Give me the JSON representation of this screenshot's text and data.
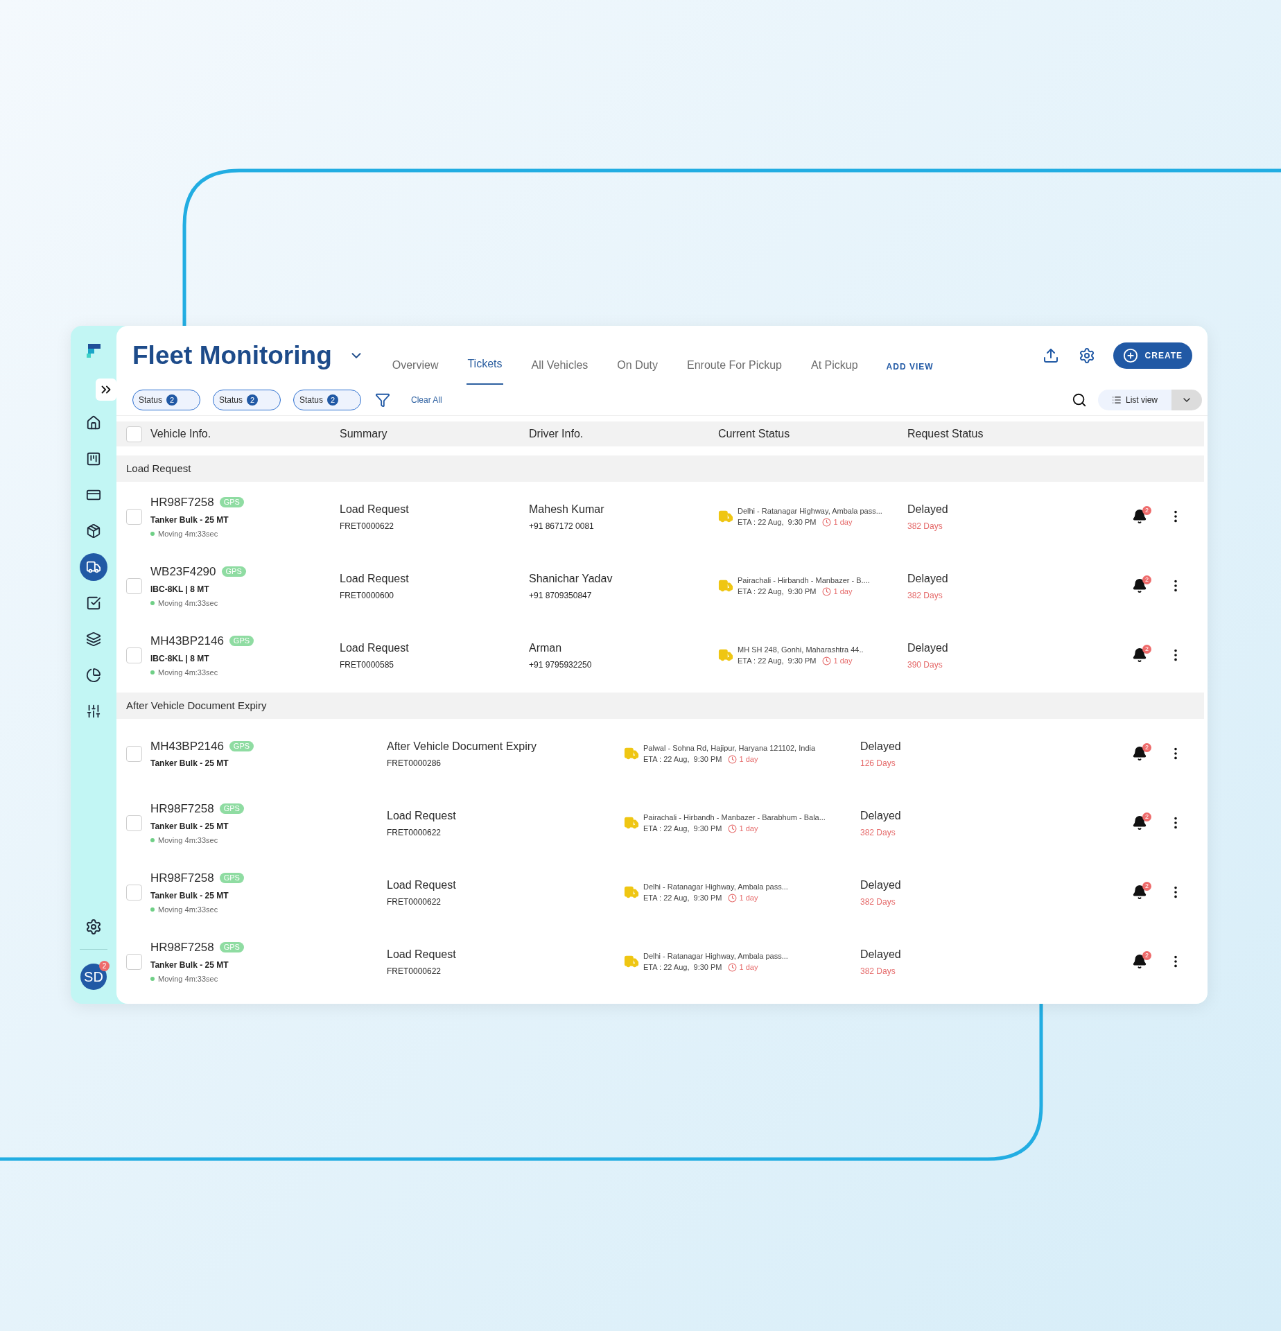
{
  "app": {
    "title": "Fleet Monitoring"
  },
  "sidebar": {
    "items": [
      {
        "selected": false
      },
      {
        "selected": false
      },
      {
        "selected": false
      },
      {
        "selected": false
      },
      {
        "selected": true
      },
      {
        "selected": false
      },
      {
        "selected": false
      },
      {
        "selected": false
      },
      {
        "selected": false
      }
    ],
    "avatar": {
      "initials": "SD",
      "badge": "2"
    }
  },
  "tabs": [
    {
      "label": "Overview",
      "selected": false
    },
    {
      "label": "Tickets",
      "selected": true
    },
    {
      "label": "All Vehicles",
      "selected": false
    },
    {
      "label": "On Duty",
      "selected": false
    },
    {
      "label": "Enroute For Pickup",
      "selected": false
    },
    {
      "label": "At Pickup",
      "selected": false
    }
  ],
  "add_view": "ADD VIEW",
  "create_button": "CREATE",
  "filters": [
    {
      "label": "Status",
      "count": "2"
    },
    {
      "label": "Status",
      "count": "2"
    },
    {
      "label": "Status",
      "count": "2"
    }
  ],
  "clear_all": "Clear All",
  "view_select": "List view",
  "table": {
    "select_all_checked": false,
    "columns": [
      "Vehicle Info.",
      "Summary",
      "Driver Info.",
      "Current Status",
      "Request Status"
    ],
    "groups": [
      {
        "title": "Load Request",
        "rows": [
          {
            "checked": false,
            "plate": "HR98F7258",
            "gps": "GPS",
            "type": "Tanker Bulk - 25 MT",
            "moving": "Moving 4m:33sec",
            "summary": "Load Request",
            "ticket": "FRET0000622",
            "driver": "Mahesh Kumar",
            "phone": "+91 867172 0081",
            "location": "Delhi - Ratanagar Highway, Ambala pass...",
            "eta": "ETA : 22 Aug,  9:30 PM",
            "duration": "1 day",
            "status": "Delayed",
            "days": "382 Days",
            "alerts": "2"
          },
          {
            "checked": false,
            "plate": "WB23F4290",
            "gps": "GPS",
            "type": "IBC-8KL  | 8 MT",
            "moving": "Moving 4m:33sec",
            "summary": "Load Request",
            "ticket": "FRET0000600",
            "driver": "Shanichar Yadav",
            "phone": "+91 8709350847",
            "location": "Pairachali - Hirbandh - Manbazer - B....",
            "eta": "ETA : 22 Aug,  9:30 PM",
            "duration": "1 day",
            "status": "Delayed",
            "days": "382 Days",
            "alerts": "2"
          },
          {
            "checked": false,
            "plate": "MH43BP2146",
            "gps": "GPS",
            "type": "IBC-8KL  | 8 MT",
            "moving": "Moving 4m:33sec",
            "summary": "Load Request",
            "ticket": "FRET0000585",
            "driver": "Arman",
            "phone": "+91 9795932250",
            "location": "MH SH 248, Gonhi, Maharashtra 44..",
            "eta": "ETA : 22 Aug,  9:30 PM",
            "duration": "1 day",
            "status": "Delayed",
            "days": "390 Days",
            "alerts": "2"
          }
        ]
      },
      {
        "title": "After Vehicle Document Expiry",
        "rows": [
          {
            "checked": false,
            "plate": "MH43BP2146",
            "gps": "GPS",
            "type": "Tanker Bulk - 25 MT",
            "summary": "After Vehicle Document Expiry",
            "ticket": "FRET0000286",
            "location": "Palwal - Sohna Rd, Hajipur, Haryana 121102, India",
            "eta": "ETA : 22 Aug,  9:30 PM",
            "duration": "1 day",
            "status": "Delayed",
            "days": "126 Days",
            "alerts": "2"
          },
          {
            "checked": false,
            "plate": "HR98F7258",
            "gps": "GPS",
            "type": "Tanker Bulk - 25 MT",
            "moving": "Moving 4m:33sec",
            "summary": "Load Request",
            "ticket": "FRET0000622",
            "location": "Pairachali - Hirbandh - Manbazer - Barabhum - Bala...",
            "eta": "ETA : 22 Aug,  9:30 PM",
            "duration": "1 day",
            "status": "Delayed",
            "days": "382 Days",
            "alerts": "2"
          },
          {
            "checked": false,
            "plate": "HR98F7258",
            "gps": "GPS",
            "type": "Tanker Bulk - 25 MT",
            "moving": "Moving 4m:33sec",
            "summary": "Load Request",
            "ticket": "FRET0000622",
            "location": "Delhi - Ratanagar Highway, Ambala pass...",
            "eta": "ETA : 22 Aug,  9:30 PM",
            "duration": "1 day",
            "status": "Delayed",
            "days": "382 Days",
            "alerts": "2"
          },
          {
            "checked": false,
            "plate": "HR98F7258",
            "gps": "GPS",
            "type": "Tanker Bulk - 25 MT",
            "moving": "Moving 4m:33sec",
            "summary": "Load Request",
            "ticket": "FRET0000622",
            "location": "Delhi - Ratanagar Highway, Ambala pass...",
            "eta": "ETA : 22 Aug,  9:30 PM",
            "duration": "1 day",
            "status": "Delayed",
            "days": "382 Days",
            "alerts": "2"
          }
        ]
      }
    ]
  }
}
